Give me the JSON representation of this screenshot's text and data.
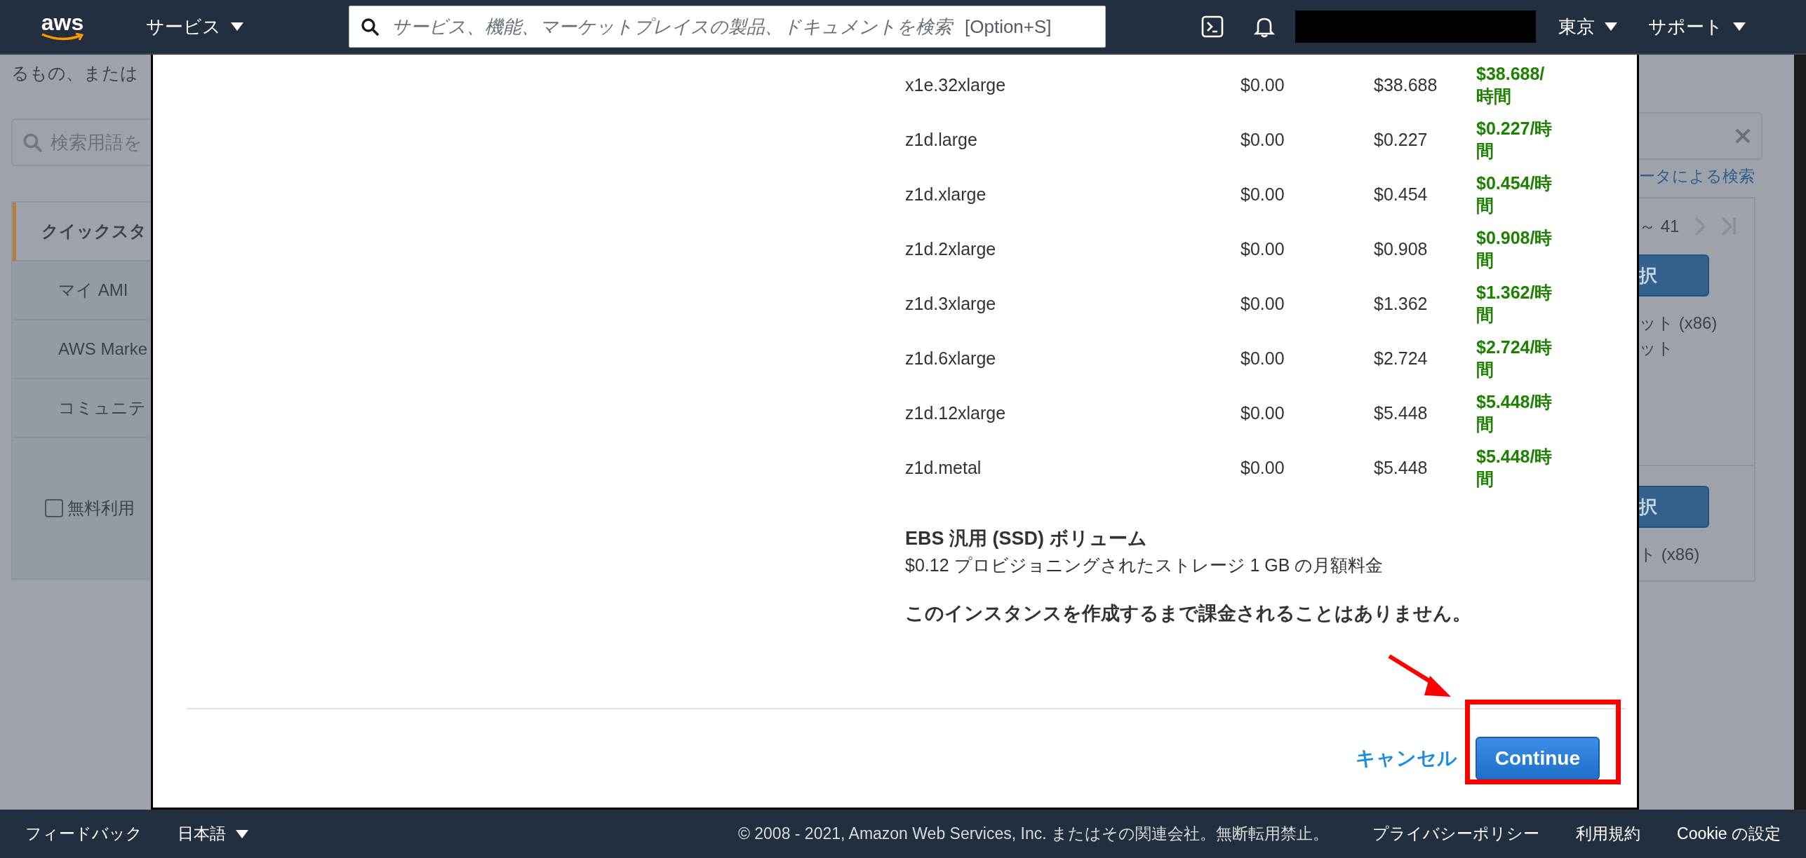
{
  "top_nav": {
    "logo_text": "aws",
    "services_label": "サービス",
    "search": {
      "placeholder": "サービス、機能、マーケットプレイスの製品、ドキュメントを検索",
      "shortcut": "[Option+S]"
    },
    "region": "東京",
    "support": "サポート"
  },
  "background_page": {
    "intro_text": "るもの、または",
    "search": {
      "placeholder": "検索用語を"
    },
    "tabs": [
      {
        "label": "クイックスタ",
        "selected": true
      },
      {
        "label": "マイ AMI",
        "selected": false
      },
      {
        "label": "AWS Marke",
        "selected": false
      },
      {
        "label": "コミュニテ",
        "selected": false
      }
    ],
    "free_tier_checkbox": {
      "label": "無料利用",
      "checked": false
    },
    "advanced_search_link": "ータによる検索",
    "pagination": "～ 41",
    "amis": [
      {
        "select_button": "択",
        "texts": [
          "ット (x86)",
          "ット"
        ]
      },
      {
        "select_button": "択",
        "texts": [
          "ト (x86)"
        ]
      }
    ]
  },
  "modal": {
    "pricing_rows": [
      {
        "instance_type": "x1e.32xlarge",
        "column_2": "$0.00",
        "column_3": "$38.688",
        "hourly": "$38.688/時間"
      },
      {
        "instance_type": "z1d.large",
        "column_2": "$0.00",
        "column_3": "$0.227",
        "hourly": "$0.227/時間"
      },
      {
        "instance_type": "z1d.xlarge",
        "column_2": "$0.00",
        "column_3": "$0.454",
        "hourly": "$0.454/時間"
      },
      {
        "instance_type": "z1d.2xlarge",
        "column_2": "$0.00",
        "column_3": "$0.908",
        "hourly": "$0.908/時間"
      },
      {
        "instance_type": "z1d.3xlarge",
        "column_2": "$0.00",
        "column_3": "$1.362",
        "hourly": "$1.362/時間"
      },
      {
        "instance_type": "z1d.6xlarge",
        "column_2": "$0.00",
        "column_3": "$2.724",
        "hourly": "$2.724/時間"
      },
      {
        "instance_type": "z1d.12xlarge",
        "column_2": "$0.00",
        "column_3": "$5.448",
        "hourly": "$5.448/時間"
      },
      {
        "instance_type": "z1d.metal",
        "column_2": "$0.00",
        "column_3": "$5.448",
        "hourly": "$5.448/時間"
      }
    ],
    "ebs": {
      "title": "EBS 汎用 (SSD) ボリューム",
      "description": "$0.12 プロビジョニングされたストレージ 1 GB の月額料金"
    },
    "notice": "このインスタンスを作成するまで課金されることはありません。",
    "cancel_link": "キャンセル",
    "continue_button": "Continue"
  },
  "footer": {
    "feedback": "フィードバック",
    "language": "日本語",
    "copyright": "© 2008 - 2021, Amazon Web Services, Inc. またはその関連会社。無断転用禁止。",
    "links": [
      "プライバシーポリシー",
      "利用規約",
      "Cookie の設定"
    ]
  }
}
